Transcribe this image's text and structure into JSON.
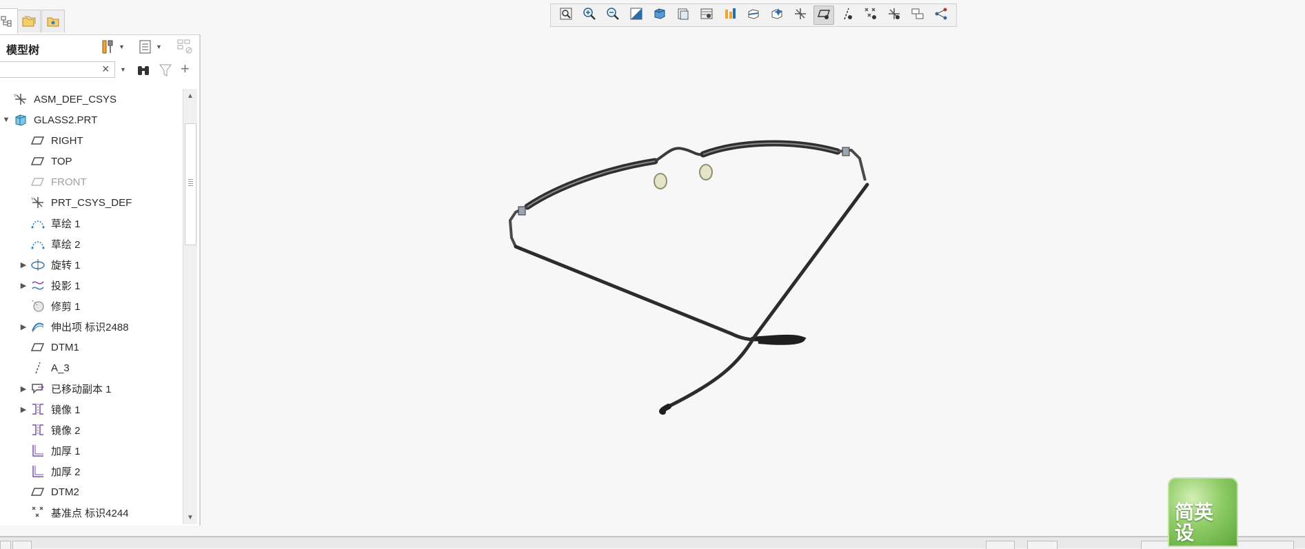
{
  "navigator": {
    "panel_title": "模型树",
    "search": {
      "value": "",
      "placeholder": ""
    },
    "tree_items": [
      {
        "label": "ASM_DEF_CSYS",
        "icon": "csys-icon",
        "level": 0,
        "expandable": false,
        "suppressed": false
      },
      {
        "label": "GLASS2.PRT",
        "icon": "part-icon",
        "level": 0,
        "expandable": true,
        "expanded": true,
        "suppressed": false
      },
      {
        "label": "RIGHT",
        "icon": "datum-plane-icon",
        "level": 1,
        "expandable": false,
        "suppressed": false
      },
      {
        "label": "TOP",
        "icon": "datum-plane-icon",
        "level": 1,
        "expandable": false,
        "suppressed": false
      },
      {
        "label": "FRONT",
        "icon": "datum-plane-icon",
        "level": 1,
        "expandable": false,
        "suppressed": true
      },
      {
        "label": "PRT_CSYS_DEF",
        "icon": "csys-icon",
        "level": 1,
        "expandable": false,
        "suppressed": false
      },
      {
        "label": "草绘 1",
        "icon": "sketch-icon",
        "level": 1,
        "expandable": false,
        "suppressed": false
      },
      {
        "label": "草绘 2",
        "icon": "sketch-icon",
        "level": 1,
        "expandable": false,
        "suppressed": false
      },
      {
        "label": "旋转 1",
        "icon": "revolve-icon",
        "level": 1,
        "expandable": true,
        "suppressed": false
      },
      {
        "label": "投影 1",
        "icon": "projection-icon",
        "level": 1,
        "expandable": true,
        "suppressed": false
      },
      {
        "label": "修剪 1",
        "icon": "trim-icon",
        "level": 1,
        "expandable": false,
        "suppressed": false
      },
      {
        "label": "伸出项 标识2488",
        "icon": "protrusion-icon",
        "level": 1,
        "expandable": true,
        "suppressed": false
      },
      {
        "label": "DTM1",
        "icon": "datum-plane-icon",
        "level": 1,
        "expandable": false,
        "suppressed": false
      },
      {
        "label": "A_3",
        "icon": "datum-axis-icon",
        "level": 1,
        "expandable": false,
        "suppressed": false
      },
      {
        "label": "已移动副本 1",
        "icon": "moved-copy-icon",
        "level": 1,
        "expandable": true,
        "suppressed": false
      },
      {
        "label": "镜像 1",
        "icon": "mirror-icon",
        "level": 1,
        "expandable": true,
        "suppressed": false
      },
      {
        "label": "镜像 2",
        "icon": "mirror-icon",
        "level": 1,
        "expandable": false,
        "suppressed": false
      },
      {
        "label": "加厚 1",
        "icon": "thicken-icon",
        "level": 1,
        "expandable": false,
        "suppressed": false
      },
      {
        "label": "加厚 2",
        "icon": "thicken-icon",
        "level": 1,
        "expandable": false,
        "suppressed": false
      },
      {
        "label": "DTM2",
        "icon": "datum-plane-icon",
        "level": 1,
        "expandable": false,
        "suppressed": false
      },
      {
        "label": "基准点 标识4244",
        "icon": "datum-point-icon",
        "level": 1,
        "expandable": false,
        "suppressed": false
      }
    ]
  },
  "graphics_toolbar": {
    "buttons": [
      {
        "name": "refit-icon",
        "pressed": false
      },
      {
        "name": "zoom-in-icon",
        "pressed": false
      },
      {
        "name": "zoom-out-icon",
        "pressed": false
      },
      {
        "name": "repaint-icon",
        "pressed": false
      },
      {
        "name": "display-style-icon",
        "pressed": false
      },
      {
        "name": "saved-orientations-icon",
        "pressed": false
      },
      {
        "name": "view-manager-icon",
        "pressed": false
      },
      {
        "name": "perspective-view-icon",
        "pressed": false
      },
      {
        "name": "section-icon",
        "pressed": false
      },
      {
        "name": "spin-center-icon",
        "pressed": false
      },
      {
        "name": "csys-display-icon",
        "pressed": false
      },
      {
        "name": "plane-display-icon",
        "pressed": true
      },
      {
        "name": "axis-display-icon",
        "pressed": false
      },
      {
        "name": "point-display-icon",
        "pressed": false
      },
      {
        "name": "csys-tag-display-icon",
        "pressed": false
      },
      {
        "name": "annotation-display-icon",
        "pressed": false
      },
      {
        "name": "network-icon",
        "pressed": false
      }
    ]
  },
  "ime_badge": {
    "text": "简英设"
  },
  "colors": {
    "accent": "#3a7fc4",
    "model": "#3b3b3b",
    "lens": "#d8d8b8"
  }
}
